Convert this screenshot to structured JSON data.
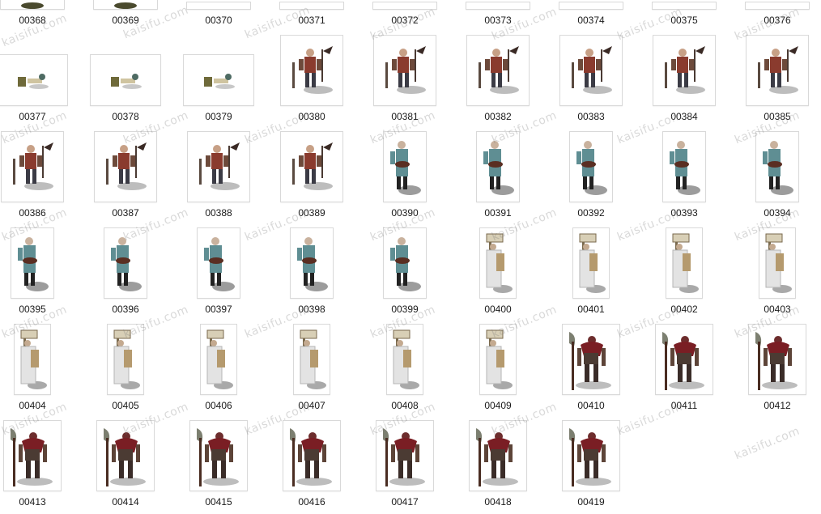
{
  "watermark": "kaisifu.com",
  "rows": [
    {
      "items": [
        {
          "name": "00368",
          "kind": "dark"
        },
        {
          "name": "00369",
          "kind": "dark"
        },
        {
          "name": "00370",
          "kind": "blank"
        },
        {
          "name": "00371",
          "kind": "blank"
        },
        {
          "name": "00372",
          "kind": "blank"
        },
        {
          "name": "00373",
          "kind": "blank"
        },
        {
          "name": "00374",
          "kind": "blank"
        },
        {
          "name": "00375",
          "kind": "blank"
        },
        {
          "name": "00376",
          "kind": "blank"
        }
      ]
    },
    {
      "items": [
        {
          "name": "00377",
          "kind": "small"
        },
        {
          "name": "00378",
          "kind": "small"
        },
        {
          "name": "00379",
          "kind": "small"
        },
        {
          "name": "00380",
          "kind": "warrior"
        },
        {
          "name": "00381",
          "kind": "warrior"
        },
        {
          "name": "00382",
          "kind": "warrior"
        },
        {
          "name": "00383",
          "kind": "warrior"
        },
        {
          "name": "00384",
          "kind": "warrior"
        },
        {
          "name": "00385",
          "kind": "warrior"
        }
      ]
    },
    {
      "items": [
        {
          "name": "00386",
          "kind": "warrior"
        },
        {
          "name": "00387",
          "kind": "warrior"
        },
        {
          "name": "00388",
          "kind": "warrior"
        },
        {
          "name": "00389",
          "kind": "warrior"
        },
        {
          "name": "00390",
          "kind": "monk"
        },
        {
          "name": "00391",
          "kind": "monk"
        },
        {
          "name": "00392",
          "kind": "monk"
        },
        {
          "name": "00393",
          "kind": "monk"
        },
        {
          "name": "00394",
          "kind": "monk"
        }
      ]
    },
    {
      "items": [
        {
          "name": "00395",
          "kind": "monk"
        },
        {
          "name": "00396",
          "kind": "monk"
        },
        {
          "name": "00397",
          "kind": "monk"
        },
        {
          "name": "00398",
          "kind": "monk"
        },
        {
          "name": "00399",
          "kind": "monk"
        },
        {
          "name": "00400",
          "kind": "porter"
        },
        {
          "name": "00401",
          "kind": "porter"
        },
        {
          "name": "00402",
          "kind": "porter"
        },
        {
          "name": "00403",
          "kind": "porter"
        }
      ]
    },
    {
      "items": [
        {
          "name": "00404",
          "kind": "porter"
        },
        {
          "name": "00405",
          "kind": "porter"
        },
        {
          "name": "00406",
          "kind": "porter"
        },
        {
          "name": "00407",
          "kind": "porter"
        },
        {
          "name": "00408",
          "kind": "porter"
        },
        {
          "name": "00409",
          "kind": "porter"
        },
        {
          "name": "00410",
          "kind": "brute"
        },
        {
          "name": "00411",
          "kind": "brute"
        },
        {
          "name": "00412",
          "kind": "brute"
        }
      ]
    },
    {
      "items": [
        {
          "name": "00413",
          "kind": "brute"
        },
        {
          "name": "00414",
          "kind": "brute"
        },
        {
          "name": "00415",
          "kind": "brute"
        },
        {
          "name": "00416",
          "kind": "brute"
        },
        {
          "name": "00417",
          "kind": "brute"
        },
        {
          "name": "00418",
          "kind": "brute"
        },
        {
          "name": "00419",
          "kind": "brute"
        }
      ]
    }
  ]
}
